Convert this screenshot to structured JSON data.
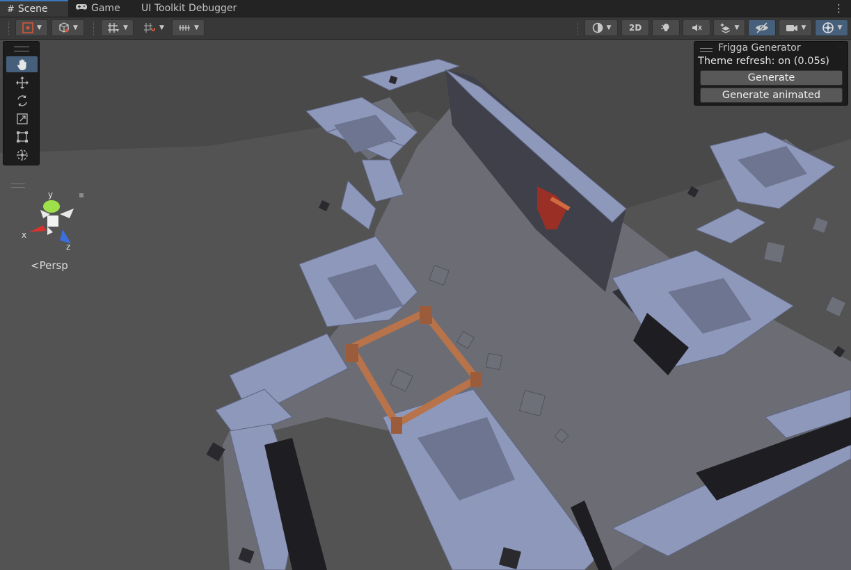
{
  "tabs": {
    "scene": "Scene",
    "game": "Game",
    "debugger": "UI Toolkit Debugger"
  },
  "toolbar": {
    "mode_2d": "2D"
  },
  "tool_palette": {
    "tools": [
      "view-hand-tool",
      "move-tool",
      "rotate-tool",
      "scale-tool",
      "rect-tool",
      "transform-tool"
    ]
  },
  "gizmo": {
    "axis_x": "x",
    "axis_y": "y",
    "axis_z": "z",
    "projection": "Persp",
    "colors": {
      "x": "#d9332c",
      "y": "#9ee04a",
      "z": "#3a6fe0"
    }
  },
  "frigga": {
    "title": "Frigga Generator",
    "status": "Theme refresh: on (0.05s)",
    "generate": "Generate",
    "generate_animated": "Generate animated"
  },
  "colors": {
    "accent": "#46607c",
    "tab_highlight": "#3a79bb",
    "stone": "#8e98bb",
    "wood": "#b8734a",
    "banner": "#9a2f26"
  }
}
